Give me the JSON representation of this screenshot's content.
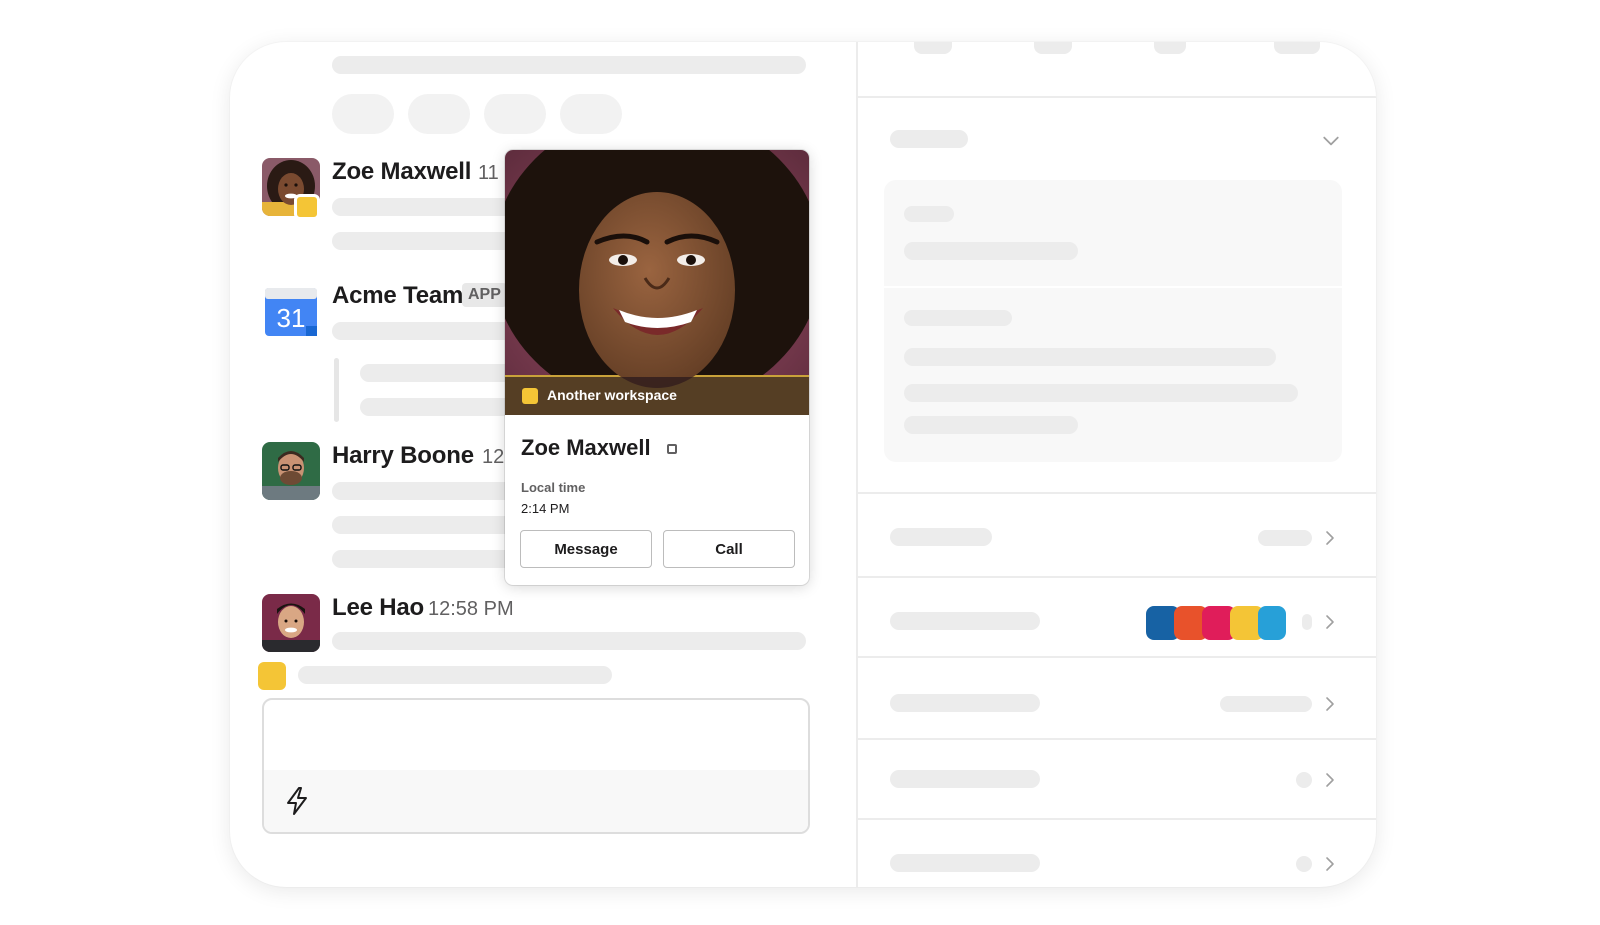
{
  "messages": [
    {
      "author": "Zoe Maxwell",
      "time": "11"
    },
    {
      "author": "Acme Team",
      "badge": "APP",
      "calendar_day": "31"
    },
    {
      "author": "Harry Boone",
      "time": "12"
    },
    {
      "author": "Lee Hao",
      "time": "12:58 PM"
    }
  ],
  "profile_card": {
    "workspace": "Another workspace",
    "name": "Zoe Maxwell",
    "local_time_label": "Local time",
    "local_time_value": "2:14 PM",
    "message_button": "Message",
    "call_button": "Call"
  },
  "colors": {
    "status_yellow": "#f4c536",
    "swatches": [
      "#1762a4",
      "#e8522b",
      "#e01d5a",
      "#f4c536",
      "#27a0d8"
    ]
  },
  "icons": {
    "composer": "lightning-icon",
    "presence": "presence-square-icon",
    "expand": "chevron-down-icon",
    "row": "chevron-right-icon"
  }
}
